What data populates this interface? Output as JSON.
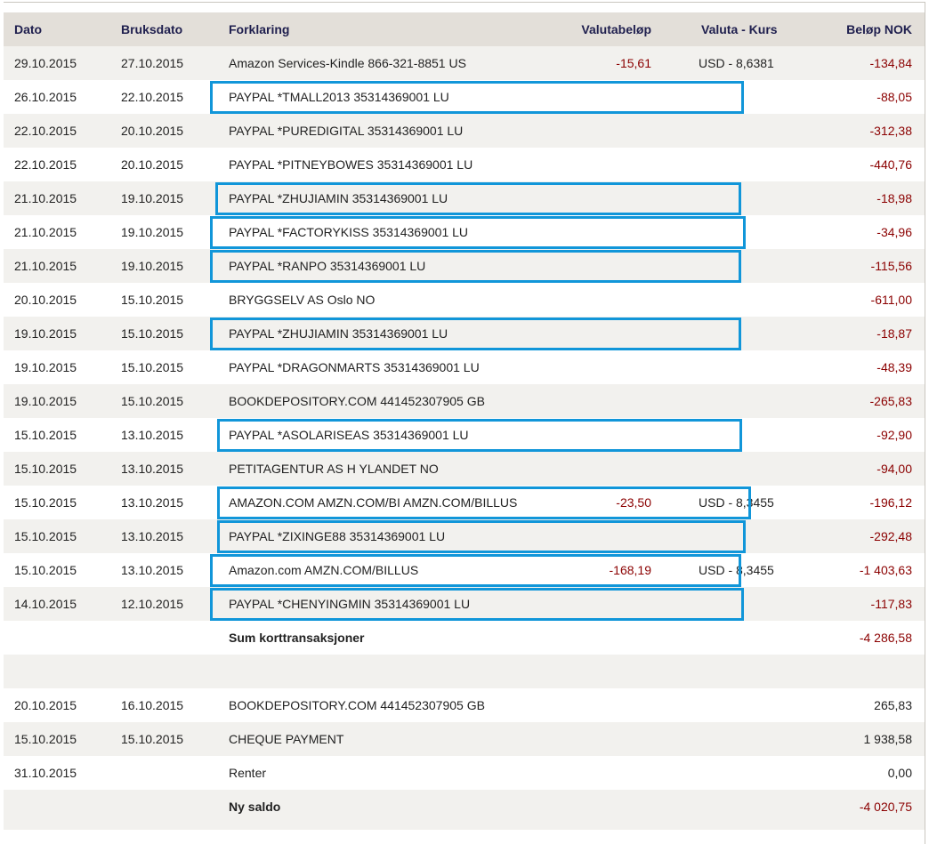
{
  "headers": {
    "date": "Dato",
    "used_date": "Bruksdato",
    "description": "Forklaring",
    "fx_amount": "Valutabeløp",
    "currency_rate": "Valuta - Kurs",
    "amount_nok": "Beløp NOK"
  },
  "transactions": [
    {
      "date": "29.10.2015",
      "used": "27.10.2015",
      "desc": "Amazon Services-Kindle 866-321-8851 US",
      "fx": "-15,61",
      "rate": "USD  - 8,6381",
      "nok": "-134,84",
      "highlighted": false
    },
    {
      "date": "26.10.2015",
      "used": "22.10.2015",
      "desc": "PAYPAL *TMALL2013 35314369001 LU",
      "fx": "",
      "rate": "",
      "nok": "-88,05",
      "highlighted": true
    },
    {
      "date": "22.10.2015",
      "used": "20.10.2015",
      "desc": "PAYPAL *PUREDIGITAL 35314369001 LU",
      "fx": "",
      "rate": "",
      "nok": "-312,38",
      "highlighted": false
    },
    {
      "date": "22.10.2015",
      "used": "20.10.2015",
      "desc": "PAYPAL *PITNEYBOWES 35314369001 LU",
      "fx": "",
      "rate": "",
      "nok": "-440,76",
      "highlighted": false
    },
    {
      "date": "21.10.2015",
      "used": "19.10.2015",
      "desc": "PAYPAL *ZHUJIAMIN 35314369001 LU",
      "fx": "",
      "rate": "",
      "nok": "-18,98",
      "highlighted": true
    },
    {
      "date": "21.10.2015",
      "used": "19.10.2015",
      "desc": "PAYPAL *FACTORYKISS 35314369001 LU",
      "fx": "",
      "rate": "",
      "nok": "-34,96",
      "highlighted": true
    },
    {
      "date": "21.10.2015",
      "used": "19.10.2015",
      "desc": "PAYPAL *RANPO 35314369001 LU",
      "fx": "",
      "rate": "",
      "nok": "-115,56",
      "highlighted": true
    },
    {
      "date": "20.10.2015",
      "used": "15.10.2015",
      "desc": "BRYGGSELV AS Oslo NO",
      "fx": "",
      "rate": "",
      "nok": "-611,00",
      "highlighted": false
    },
    {
      "date": "19.10.2015",
      "used": "15.10.2015",
      "desc": "PAYPAL *ZHUJIAMIN 35314369001 LU",
      "fx": "",
      "rate": "",
      "nok": "-18,87",
      "highlighted": true
    },
    {
      "date": "19.10.2015",
      "used": "15.10.2015",
      "desc": "PAYPAL *DRAGONMARTS 35314369001 LU",
      "fx": "",
      "rate": "",
      "nok": "-48,39",
      "highlighted": false
    },
    {
      "date": "19.10.2015",
      "used": "15.10.2015",
      "desc": "BOOKDEPOSITORY.COM 441452307905 GB",
      "fx": "",
      "rate": "",
      "nok": "-265,83",
      "highlighted": false
    },
    {
      "date": "15.10.2015",
      "used": "13.10.2015",
      "desc": "PAYPAL *ASOLARISEAS 35314369001 LU",
      "fx": "",
      "rate": "",
      "nok": "-92,90",
      "highlighted": true
    },
    {
      "date": "15.10.2015",
      "used": "13.10.2015",
      "desc": "PETITAGENTUR AS H YLANDET NO",
      "fx": "",
      "rate": "",
      "nok": "-94,00",
      "highlighted": false
    },
    {
      "date": "15.10.2015",
      "used": "13.10.2015",
      "desc": "AMAZON.COM AMZN.COM/BI AMZN.COM/BILLUS",
      "fx": "-23,50",
      "rate": "USD  - 8,3455",
      "nok": "-196,12",
      "highlighted": true
    },
    {
      "date": "15.10.2015",
      "used": "13.10.2015",
      "desc": "PAYPAL *ZIXINGE88 35314369001 LU",
      "fx": "",
      "rate": "",
      "nok": "-292,48",
      "highlighted": true
    },
    {
      "date": "15.10.2015",
      "used": "13.10.2015",
      "desc": "Amazon.com AMZN.COM/BILLUS",
      "fx": "-168,19",
      "rate": "USD  - 8,3455",
      "nok": "-1 403,63",
      "highlighted": true
    },
    {
      "date": "14.10.2015",
      "used": "12.10.2015",
      "desc": "PAYPAL *CHENYINGMIN 35314369001 LU",
      "fx": "",
      "rate": "",
      "nok": "-117,83",
      "highlighted": true
    }
  ],
  "sum": {
    "label": "Sum korttransaksjoner",
    "nok": "-4 286,58"
  },
  "other": [
    {
      "date": "20.10.2015",
      "used": "16.10.2015",
      "desc": "BOOKDEPOSITORY.COM 441452307905 GB",
      "nok": "265,83"
    },
    {
      "date": "15.10.2015",
      "used": "15.10.2015",
      "desc": "CHEQUE PAYMENT",
      "nok": "1 938,58"
    },
    {
      "date": "31.10.2015",
      "used": "",
      "desc": "Renter",
      "nok": "0,00"
    }
  ],
  "balance": {
    "label": "Ny saldo",
    "nok": "-4 020,75"
  },
  "colors": {
    "highlight": "#1196d9",
    "negative": "#8b0000",
    "header_bg": "#e3dfd9",
    "header_text": "#1f1f4e"
  }
}
